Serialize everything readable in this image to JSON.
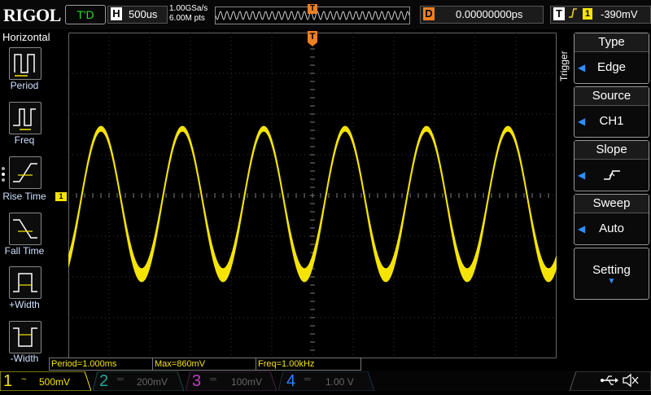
{
  "top": {
    "logo": "RIGOL",
    "run_status": "T'D",
    "timebase_letter": "H",
    "timebase": "500us",
    "sample_rate": "1.00GSa/s",
    "mem_depth": "6.00M pts",
    "delay_letter": "D",
    "delay": "0.00000000ps",
    "trigger_letter": "T",
    "trigger_source": "1",
    "trigger_level": "-390mV",
    "trigger_marker": "T"
  },
  "left_menu": {
    "title": "Horizontal",
    "items": [
      {
        "label": "Period"
      },
      {
        "label": "Freq"
      },
      {
        "label": "Rise Time"
      },
      {
        "label": "Fall Time"
      },
      {
        "label": "+Width"
      },
      {
        "label": "-Width"
      }
    ]
  },
  "channel_marker": "1",
  "right_menu": {
    "vertical_label": "Trigger",
    "type_title": "Type",
    "type_value": "Edge",
    "source_title": "Source",
    "source_value": "CH1",
    "slope_title": "Slope",
    "sweep_title": "Sweep",
    "sweep_value": "Auto",
    "setting_title": "Setting"
  },
  "measurements": {
    "period": "Period=1.000ms",
    "max": "Max=860mV",
    "freq": "Freq=1.00kHz"
  },
  "channels": [
    {
      "num": "1",
      "scale": "500mV",
      "color": "#f5e400"
    },
    {
      "num": "2",
      "scale": "200mV",
      "color": "#1fa7a0"
    },
    {
      "num": "3",
      "scale": "100mV",
      "color": "#c040c0"
    },
    {
      "num": "4",
      "scale": "1.00 V",
      "color": "#2e7fff"
    }
  ],
  "waveform": {
    "channel": "CH1",
    "color": "#f5e400",
    "cycles_on_screen": 6
  },
  "icons": [
    "usb-icon",
    "speaker-mute-icon"
  ]
}
